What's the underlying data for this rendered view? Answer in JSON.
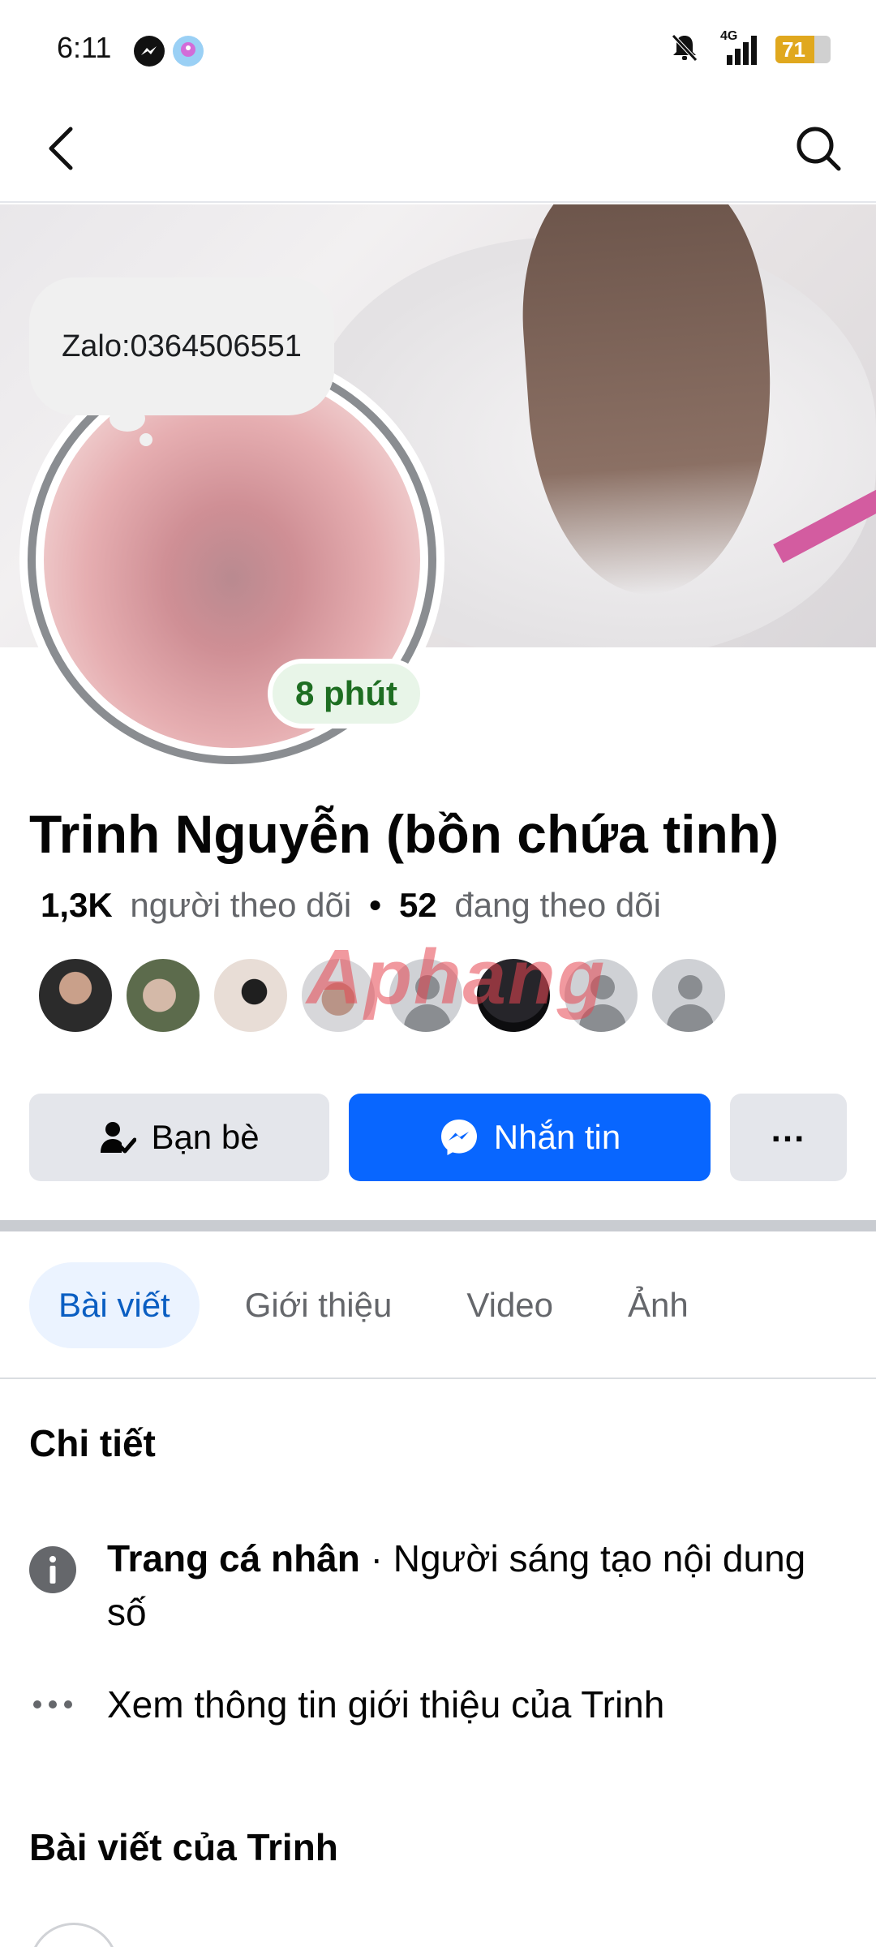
{
  "status_bar": {
    "time": "6:11",
    "network": "4G",
    "battery": "71",
    "battery_level": 0.71
  },
  "nav": {
    "back_icon": "chevron-left-icon",
    "search_icon": "search-icon"
  },
  "profile": {
    "note": "Zalo:0364506551",
    "active_status": "8 phút",
    "name": "Trinh Nguyễn (bồn chứa tinh)",
    "followers_count": "1,3K",
    "followers_label": "người theo dõi",
    "separator": "•",
    "following_count": "52",
    "following_label": "đang theo dõi",
    "watermark": "Aphang"
  },
  "actions": {
    "friends_label": "Bạn bè",
    "message_label": "Nhắn tin",
    "more_label": "..."
  },
  "tabs": [
    {
      "label": "Bài viết",
      "active": true
    },
    {
      "label": "Giới thiệu",
      "active": false
    },
    {
      "label": "Video",
      "active": false
    },
    {
      "label": "Ảnh",
      "active": false
    }
  ],
  "details": {
    "title": "Chi tiết",
    "profile_type_bold": "Trang cá nhân",
    "profile_type_rest": " · Người sáng tạo nội dung số",
    "see_about": "Xem thông tin giới thiệu của Trinh"
  },
  "posts": {
    "title": "Bài viết của Trinh"
  },
  "colors": {
    "primary_blue": "#0866ff",
    "active_green": "#1e6e22",
    "tab_active_bg": "#ebf3ff"
  }
}
